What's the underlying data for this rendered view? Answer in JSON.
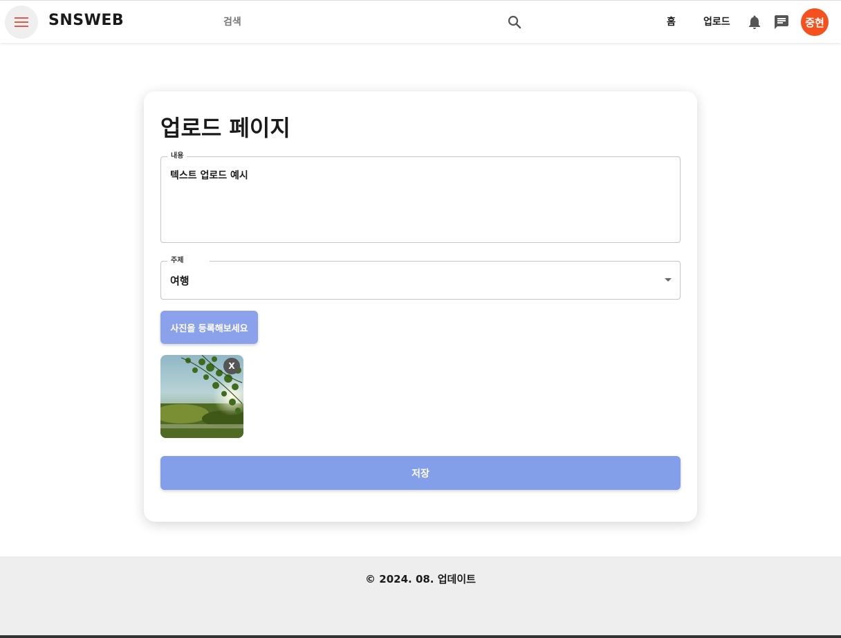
{
  "header": {
    "brand": "SNSWEB",
    "search_label": "검색",
    "nav": {
      "home": "홈",
      "upload": "업로드"
    },
    "avatar_text": "중현",
    "icons": [
      "menu-icon",
      "search-icon",
      "bell-icon",
      "chat-icon"
    ]
  },
  "form": {
    "title": "업로드 페이지",
    "content": {
      "label": "내용",
      "value": "텍스트 업로드 예시"
    },
    "topic": {
      "label": "주제",
      "value": "여행"
    },
    "photo_button": "사진을 등록해보세요",
    "thumbnail_close": "X",
    "save_button": "저장"
  },
  "footer": {
    "text": "© 2024. 08. 업데이트"
  },
  "colors": {
    "accent_button": "#849fea",
    "avatar_bg": "#f4511e",
    "menu_icon": "#e05a4a",
    "footer_bg": "#eeeeee"
  }
}
